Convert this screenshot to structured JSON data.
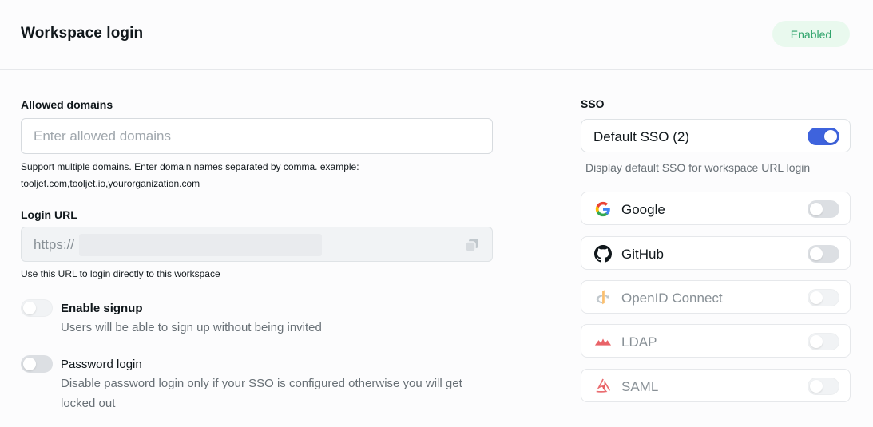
{
  "header": {
    "title": "Workspace login",
    "status": "Enabled"
  },
  "allowed_domains": {
    "label": "Allowed domains",
    "placeholder": "Enter allowed domains",
    "value": "",
    "helper_line1": "Support multiple domains. Enter domain names separated by comma. example:",
    "helper_line2": "tooljet.com,tooljet.io,yourorganization.com"
  },
  "login_url": {
    "label": "Login URL",
    "value": "https://",
    "helper": "Use this URL to login directly to this workspace"
  },
  "options": {
    "signup": {
      "title": "Enable signup",
      "desc": "Users will be able to sign up without being invited",
      "enabled": false
    },
    "password": {
      "title": "Password login",
      "desc_line1": "Disable password login only if your SSO is configured otherwise you will get",
      "desc_line2": "locked out",
      "enabled": false
    }
  },
  "sso": {
    "title": "SSO",
    "default_label": "Default SSO (2)",
    "default_enabled": true,
    "default_note": "Display default SSO for workspace URL login",
    "providers": [
      {
        "name": "Google",
        "icon": "google-icon",
        "enabled": false
      },
      {
        "name": "GitHub",
        "icon": "github-icon",
        "enabled": false
      },
      {
        "name": "OpenID Connect",
        "icon": "openid-icon",
        "enabled": false
      },
      {
        "name": "LDAP",
        "icon": "ldap-icon",
        "enabled": false
      },
      {
        "name": "SAML",
        "icon": "saml-icon",
        "enabled": false
      }
    ]
  },
  "colors": {
    "accent": "#3e63dd",
    "success_bg": "#e9f9ee",
    "success_text": "#30a46c"
  }
}
